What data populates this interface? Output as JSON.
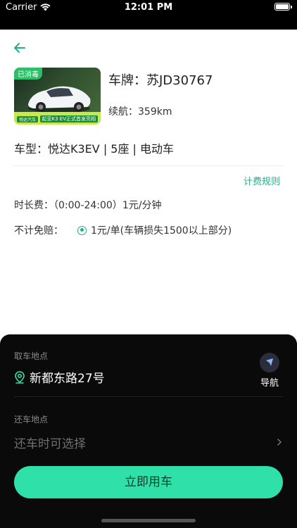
{
  "status_bar": {
    "carrier": "Carrier",
    "time": "12:01 PM",
    "icons": [
      "wifi-icon",
      "battery-icon"
    ]
  },
  "vehicle": {
    "photo_badge": "已消毒",
    "photo_ad_text": "起亚K3 EV正式首发亮相",
    "photo_brand": "悦达汽车",
    "plate": "车牌：苏JD30767",
    "range": "续航：359km",
    "model": "车型：悦达K3EV  |  5座  |  电动车"
  },
  "billing": {
    "rules_link": "计费规则",
    "time_fee": "时长费：（0:00-24:00）1元/分钟",
    "waiver_label": "不计免赔：",
    "waiver_option": "1元/单(车辆损失1500以上部分)",
    "waiver_selected": true
  },
  "bottom": {
    "pickup_label": "取车地点",
    "pickup_address": "新都东路27号",
    "nav_label": "导航",
    "return_label": "还车地点",
    "return_placeholder": "还车时可选择",
    "cta_label": "立即用车"
  },
  "colors": {
    "accent": "#1fb08a",
    "cta": "#2fe0a8",
    "panel": "#0a0a0a",
    "status_bar": "#000000"
  }
}
